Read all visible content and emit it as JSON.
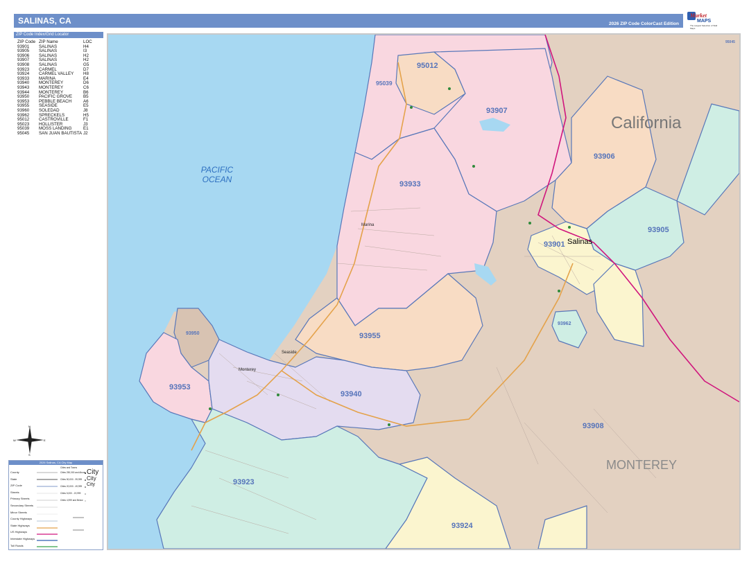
{
  "header": {
    "title": "SALINAS, CA",
    "edition": "2026 ZIP Code ColorCast Edition"
  },
  "logo": {
    "brand_top": "Market",
    "brand_bottom": "MAPS",
    "tagline": "The Largest Selection of Wall Maps"
  },
  "index": {
    "title": "ZIP Code Index/Grid Locator",
    "columns": [
      "ZIP Code",
      "ZIP Name",
      "LOC"
    ],
    "rows": [
      [
        "93901",
        "SALINAS",
        "H4"
      ],
      [
        "93905",
        "SALINAS",
        "I3"
      ],
      [
        "93906",
        "SALINAS",
        "H2"
      ],
      [
        "93907",
        "SALINAS",
        "H2"
      ],
      [
        "93908",
        "SALINAS",
        "G5"
      ],
      [
        "93923",
        "CARMEL",
        "D7"
      ],
      [
        "93924",
        "CARMEL VALLEY",
        "H8"
      ],
      [
        "93933",
        "MARINA",
        "E4"
      ],
      [
        "93940",
        "MONTEREY",
        "D6"
      ],
      [
        "93943",
        "MONTEREY",
        "C6"
      ],
      [
        "93944",
        "MONTEREY",
        "B6"
      ],
      [
        "93950",
        "PACIFIC GROVE",
        "B5"
      ],
      [
        "93953",
        "PEBBLE BEACH",
        "A6"
      ],
      [
        "93955",
        "SEASIDE",
        "E5"
      ],
      [
        "93960",
        "SOLEDAD",
        "J8"
      ],
      [
        "93962",
        "SPRECKELS",
        "H5"
      ],
      [
        "95012",
        "CASTROVILLE",
        "F1"
      ],
      [
        "95023",
        "HOLLISTER",
        "J3"
      ],
      [
        "95039",
        "MOSS LANDING",
        "E1"
      ],
      [
        "95045",
        "SAN JUAN BAUTISTA",
        "J2"
      ]
    ]
  },
  "map": {
    "colors": {
      "ocean": "#a7d8f2",
      "pink": "#f9d7e0",
      "tan": "#e3d1c1",
      "peach": "#f8dcc4",
      "mint": "#cfeee4",
      "yellow": "#fbf5cf",
      "lavender": "#e4dcf0",
      "border": "#5877b9",
      "highway": "#e4a24a",
      "interstate": "#d0157d"
    },
    "state_label": "California",
    "county_label": "MONTEREY",
    "ocean_label_1": "PACIFIC",
    "ocean_label_2": "OCEAN",
    "zip_labels": {
      "z95012": "95012",
      "z95039": "95039",
      "z93907": "93907",
      "z93906": "93906",
      "z93933": "93933",
      "z93901": "93901",
      "z93905": "93905",
      "z93962": "93962",
      "z93955": "93955",
      "z93950": "93950",
      "z93953": "93953",
      "z93940": "93940",
      "z93908": "93908",
      "z93923": "93923",
      "z93924": "93924",
      "z95045": "95045"
    },
    "cities": {
      "salinas": "Salinas",
      "marina": "Marina",
      "seaside": "Seaside",
      "monterey": "Monterey"
    }
  },
  "legend": {
    "title": "2026 Salinas, CA City Map",
    "items": [
      "County",
      "State",
      "ZIP Code",
      "Streets",
      "Primary Streets",
      "Secondary Streets",
      "Minor Streets",
      "County Highways",
      "State Highways",
      "US Highways",
      "Interstate Highways",
      "Toll Roads"
    ],
    "city_heading": "Cities and Towns",
    "city_sizes": [
      "Cities 250,000 and Above",
      "Cities 50,000 - 99,999",
      "Cities 20,000 - 49,999",
      "Cities 5,000 - 19,999",
      "Cities 4,999 and Below"
    ],
    "city_samples": [
      "City",
      "City",
      "City"
    ]
  },
  "compass": {
    "n": "N",
    "s": "S",
    "e": "E",
    "w": "W"
  }
}
